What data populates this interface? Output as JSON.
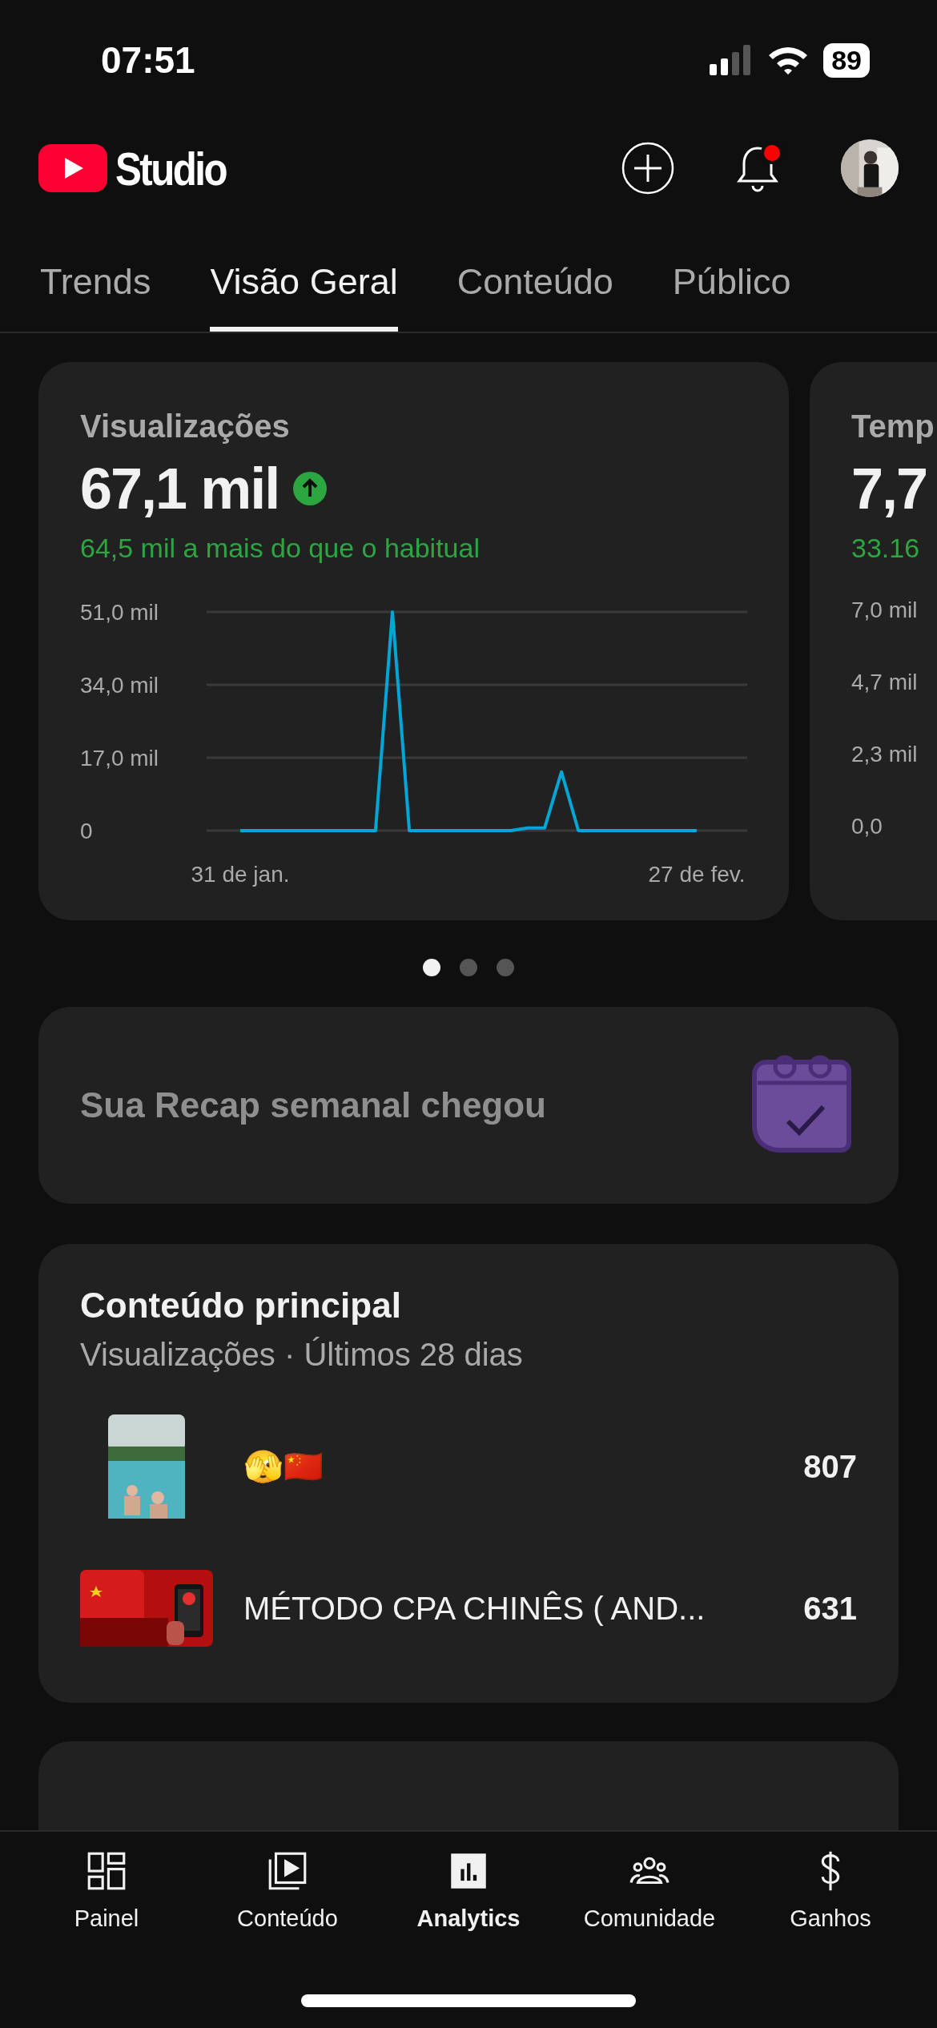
{
  "status_bar": {
    "time": "07:51",
    "battery": "89"
  },
  "header": {
    "logo_text": "Studio",
    "notification_badge": true
  },
  "tabs": [
    {
      "label": "Trends",
      "selected": false
    },
    {
      "label": "Visão Geral",
      "selected": true
    },
    {
      "label": "Conteúdo",
      "selected": false
    },
    {
      "label": "Público",
      "selected": false
    }
  ],
  "metric_cards": [
    {
      "kind": "rising",
      "title": "Visualizações",
      "value": "67,1 mil",
      "comparison": "64,5 mil a mais do que o habitual",
      "chart_data": {
        "type": "line",
        "categories": [
          "31 de jan.",
          null,
          null,
          null,
          null,
          null,
          null,
          null,
          null,
          null,
          null,
          null,
          null,
          null,
          null,
          null,
          null,
          null,
          null,
          null,
          null,
          null,
          null,
          null,
          null,
          null,
          null,
          "27 de fev."
        ],
        "yticks": [
          {
            "value": 0,
            "label": "0"
          },
          {
            "value": 17,
            "label": "17,0 mil"
          },
          {
            "value": 34,
            "label": "34,0 mil"
          },
          {
            "value": 51,
            "label": "51,0 mil"
          }
        ],
        "ylim": [
          0,
          51
        ],
        "series": [
          {
            "color": "#00a6d6",
            "values": [
              0,
              0,
              0,
              0,
              0,
              0,
              0,
              0,
              0,
              51,
              0,
              0,
              0,
              0,
              0,
              0,
              0,
              0.6,
              0.6,
              13.7,
              0,
              0,
              0,
              0,
              0,
              0,
              0,
              0
            ]
          }
        ]
      }
    },
    {
      "kind": "plain",
      "title": "Temp",
      "value": "7,7",
      "comparison": "33.16",
      "y_ticks": [
        "7,0 mil",
        "4,7 mil",
        "2,3 mil",
        "0,0"
      ]
    }
  ],
  "carousel_dots": [
    {
      "selected": true
    },
    {
      "selected": false
    },
    {
      "selected": false
    }
  ],
  "recap": {
    "text": "Sua Recap semanal chegou"
  },
  "top_content": {
    "title": "Conteúdo principal",
    "subtitle": "Visualizações · Últimos 28 dias",
    "rows": [
      {
        "kind": "portrait",
        "title": "🫣🇨🇳",
        "views": "807"
      },
      {
        "kind": "landscape",
        "title": "MÉTODO CPA CHINÊS ( AND...",
        "views": "631"
      }
    ]
  },
  "bottom_nav": [
    {
      "kind": "panel",
      "label": "Painel",
      "selected": false
    },
    {
      "kind": "content",
      "label": "Conteúdo",
      "selected": false
    },
    {
      "kind": "analytics",
      "label": "Analytics",
      "selected": true
    },
    {
      "kind": "community",
      "label": "Comunidade",
      "selected": false
    },
    {
      "kind": "earnings",
      "label": "Ganhos",
      "selected": false
    }
  ]
}
